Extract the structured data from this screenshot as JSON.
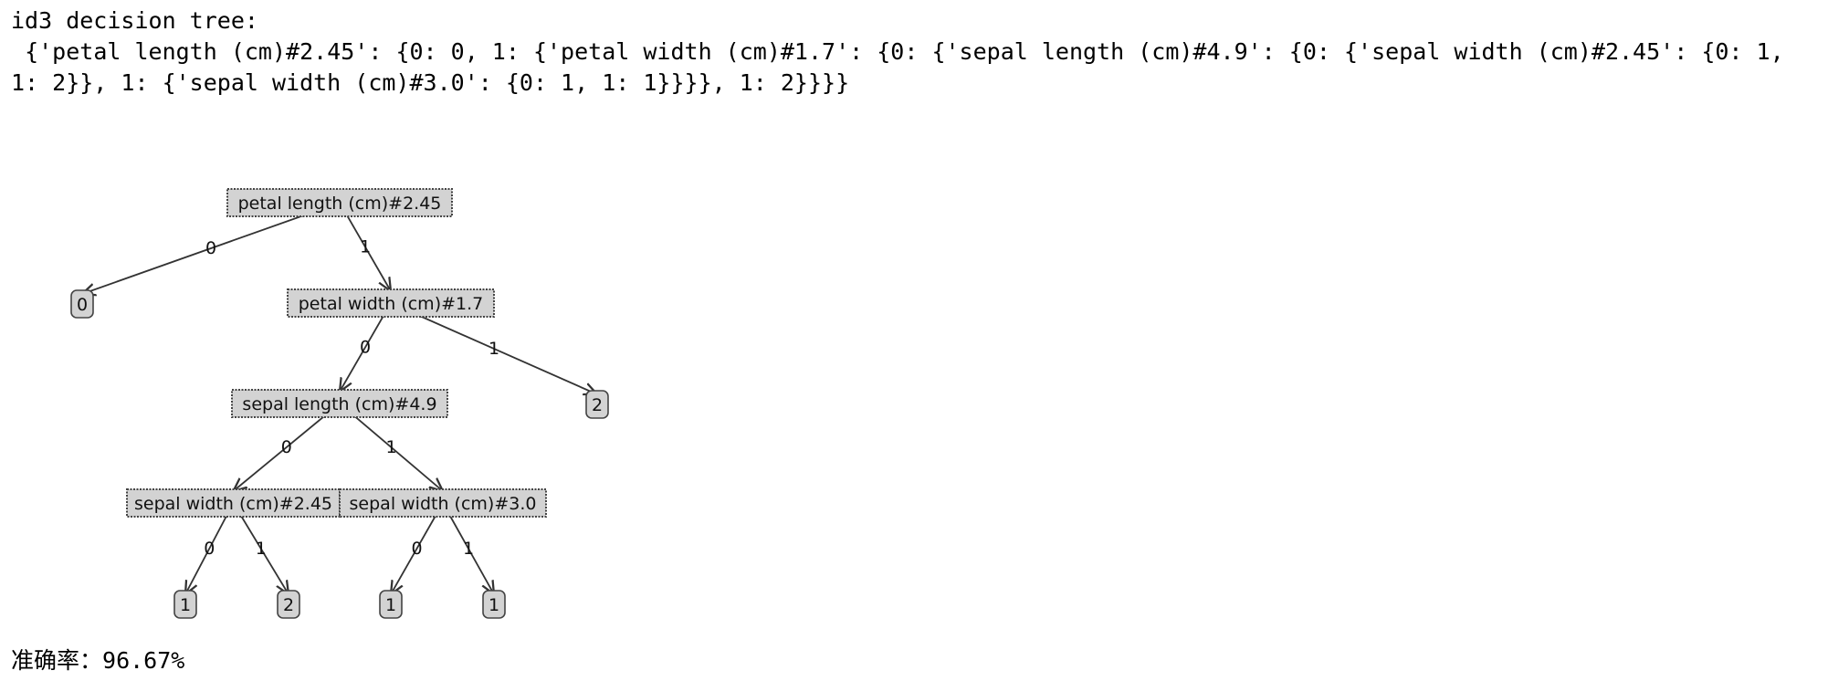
{
  "output": {
    "heading": "id3 decision tree:",
    "tree_repr": " {'petal length (cm)#2.45': {0: 0, 1: {'petal width (cm)#1.7': {0: {'sepal length (cm)#4.9': {0: {'sepal width (cm)#2.45': {0: 1, 1: 2}}, 1: {'sepal width (cm)#3.0': {0: 1, 1: 1}}}}, 1: 2}}}}",
    "accuracy_label": "准确率：",
    "accuracy_value": "96.67%"
  },
  "tree": {
    "nodes": [
      {
        "id": "n_pl",
        "label": "petal length (cm)#2.45",
        "kind": "decision"
      },
      {
        "id": "l_0a",
        "label": "0",
        "kind": "leaf"
      },
      {
        "id": "n_pw",
        "label": "petal width (cm)#1.7",
        "kind": "decision"
      },
      {
        "id": "n_sl",
        "label": "sepal length (cm)#4.9",
        "kind": "decision"
      },
      {
        "id": "l_2a",
        "label": "2",
        "kind": "leaf"
      },
      {
        "id": "n_sw1",
        "label": "sepal width (cm)#2.45",
        "kind": "decision"
      },
      {
        "id": "n_sw2",
        "label": "sepal width (cm)#3.0",
        "kind": "decision"
      },
      {
        "id": "l_1a",
        "label": "1",
        "kind": "leaf"
      },
      {
        "id": "l_2b",
        "label": "2",
        "kind": "leaf"
      },
      {
        "id": "l_1b",
        "label": "1",
        "kind": "leaf"
      },
      {
        "id": "l_1c",
        "label": "1",
        "kind": "leaf"
      }
    ],
    "edges": [
      {
        "from": "n_pl",
        "to": "l_0a",
        "label": "0"
      },
      {
        "from": "n_pl",
        "to": "n_pw",
        "label": "1"
      },
      {
        "from": "n_pw",
        "to": "n_sl",
        "label": "0"
      },
      {
        "from": "n_pw",
        "to": "l_2a",
        "label": "1"
      },
      {
        "from": "n_sl",
        "to": "n_sw1",
        "label": "0"
      },
      {
        "from": "n_sl",
        "to": "n_sw2",
        "label": "1"
      },
      {
        "from": "n_sw1",
        "to": "l_1a",
        "label": "0"
      },
      {
        "from": "n_sw1",
        "to": "l_2b",
        "label": "1"
      },
      {
        "from": "n_sw2",
        "to": "l_1b",
        "label": "0"
      },
      {
        "from": "n_sw2",
        "to": "l_1c",
        "label": "1"
      }
    ],
    "colors": {
      "box_fill": "#d3d3d3",
      "box_stroke": "#444444",
      "edge": "#333333",
      "text": "#111111"
    }
  }
}
